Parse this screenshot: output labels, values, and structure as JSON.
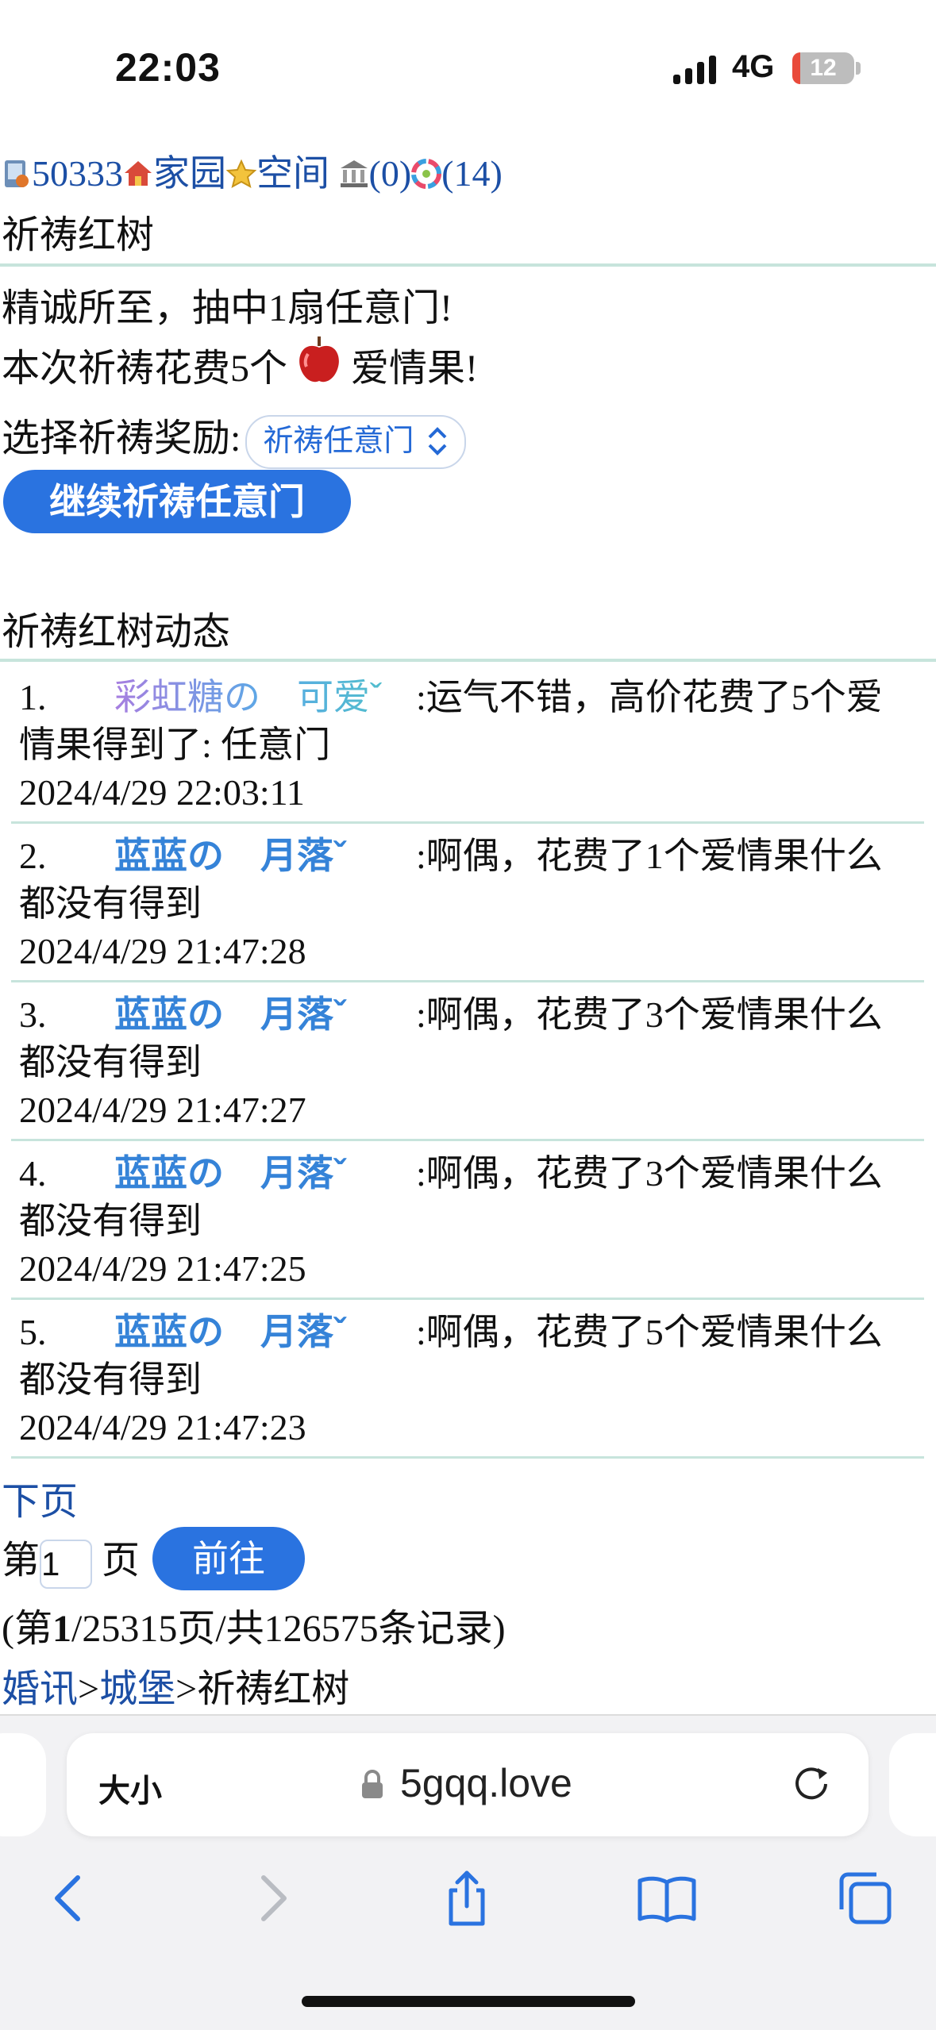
{
  "status_bar": {
    "time": "22:03",
    "network": "4G",
    "battery": "12"
  },
  "top_nav": {
    "user_id": "50333",
    "home": "家园",
    "space": "空间",
    "bank_count": "(0)",
    "album_count": "(14)"
  },
  "page_title": "祈祷红树",
  "result": {
    "line1": "精诚所至，抽中1扇任意门!",
    "cost_prefix": "本次祈祷花费5个",
    "cost_suffix": "爱情果!",
    "reward_label": "选择祈祷奖励:",
    "reward_selected": "祈祷任意门",
    "continue_button": "继续祈祷任意门"
  },
  "feed": {
    "title": "祈祷红树动态",
    "items": [
      {
        "num": "1.",
        "nick": "彩虹糖の　可爱ˇ",
        "msg": ":运气不错，高价花费了5个爱情果得到了: 任意门",
        "time": "2024/4/29 22:03:11",
        "rainbow": true
      },
      {
        "num": "2.",
        "nick": "蓝蓝の　月落ˇ",
        "msg": ":啊偶，花费了1个爱情果什么都没有得到",
        "time": "2024/4/29 21:47:28"
      },
      {
        "num": "3.",
        "nick": "蓝蓝の　月落ˇ",
        "msg": ":啊偶，花费了3个爱情果什么都没有得到",
        "time": "2024/4/29 21:47:27"
      },
      {
        "num": "4.",
        "nick": "蓝蓝の　月落ˇ",
        "msg": ":啊偶，花费了3个爱情果什么都没有得到",
        "time": "2024/4/29 21:47:25"
      },
      {
        "num": "5.",
        "nick": "蓝蓝の　月落ˇ",
        "msg": ":啊偶，花费了5个爱情果什么都没有得到",
        "time": "2024/4/29 21:47:23"
      }
    ]
  },
  "pagination": {
    "next": "下页",
    "page_prefix": "第",
    "page_value": "1",
    "page_suffix": "页",
    "go_button": "前往",
    "summary_prefix": "(第",
    "summary_current": "1",
    "summary_rest": "/25315页/共126575条记录)"
  },
  "breadcrumb": {
    "a": "婚讯",
    "sep1": ">",
    "b": "城堡",
    "sep2": ">",
    "current": "祈祷红树"
  },
  "browser": {
    "text_size": "大小",
    "domain": "5gqq.love"
  }
}
